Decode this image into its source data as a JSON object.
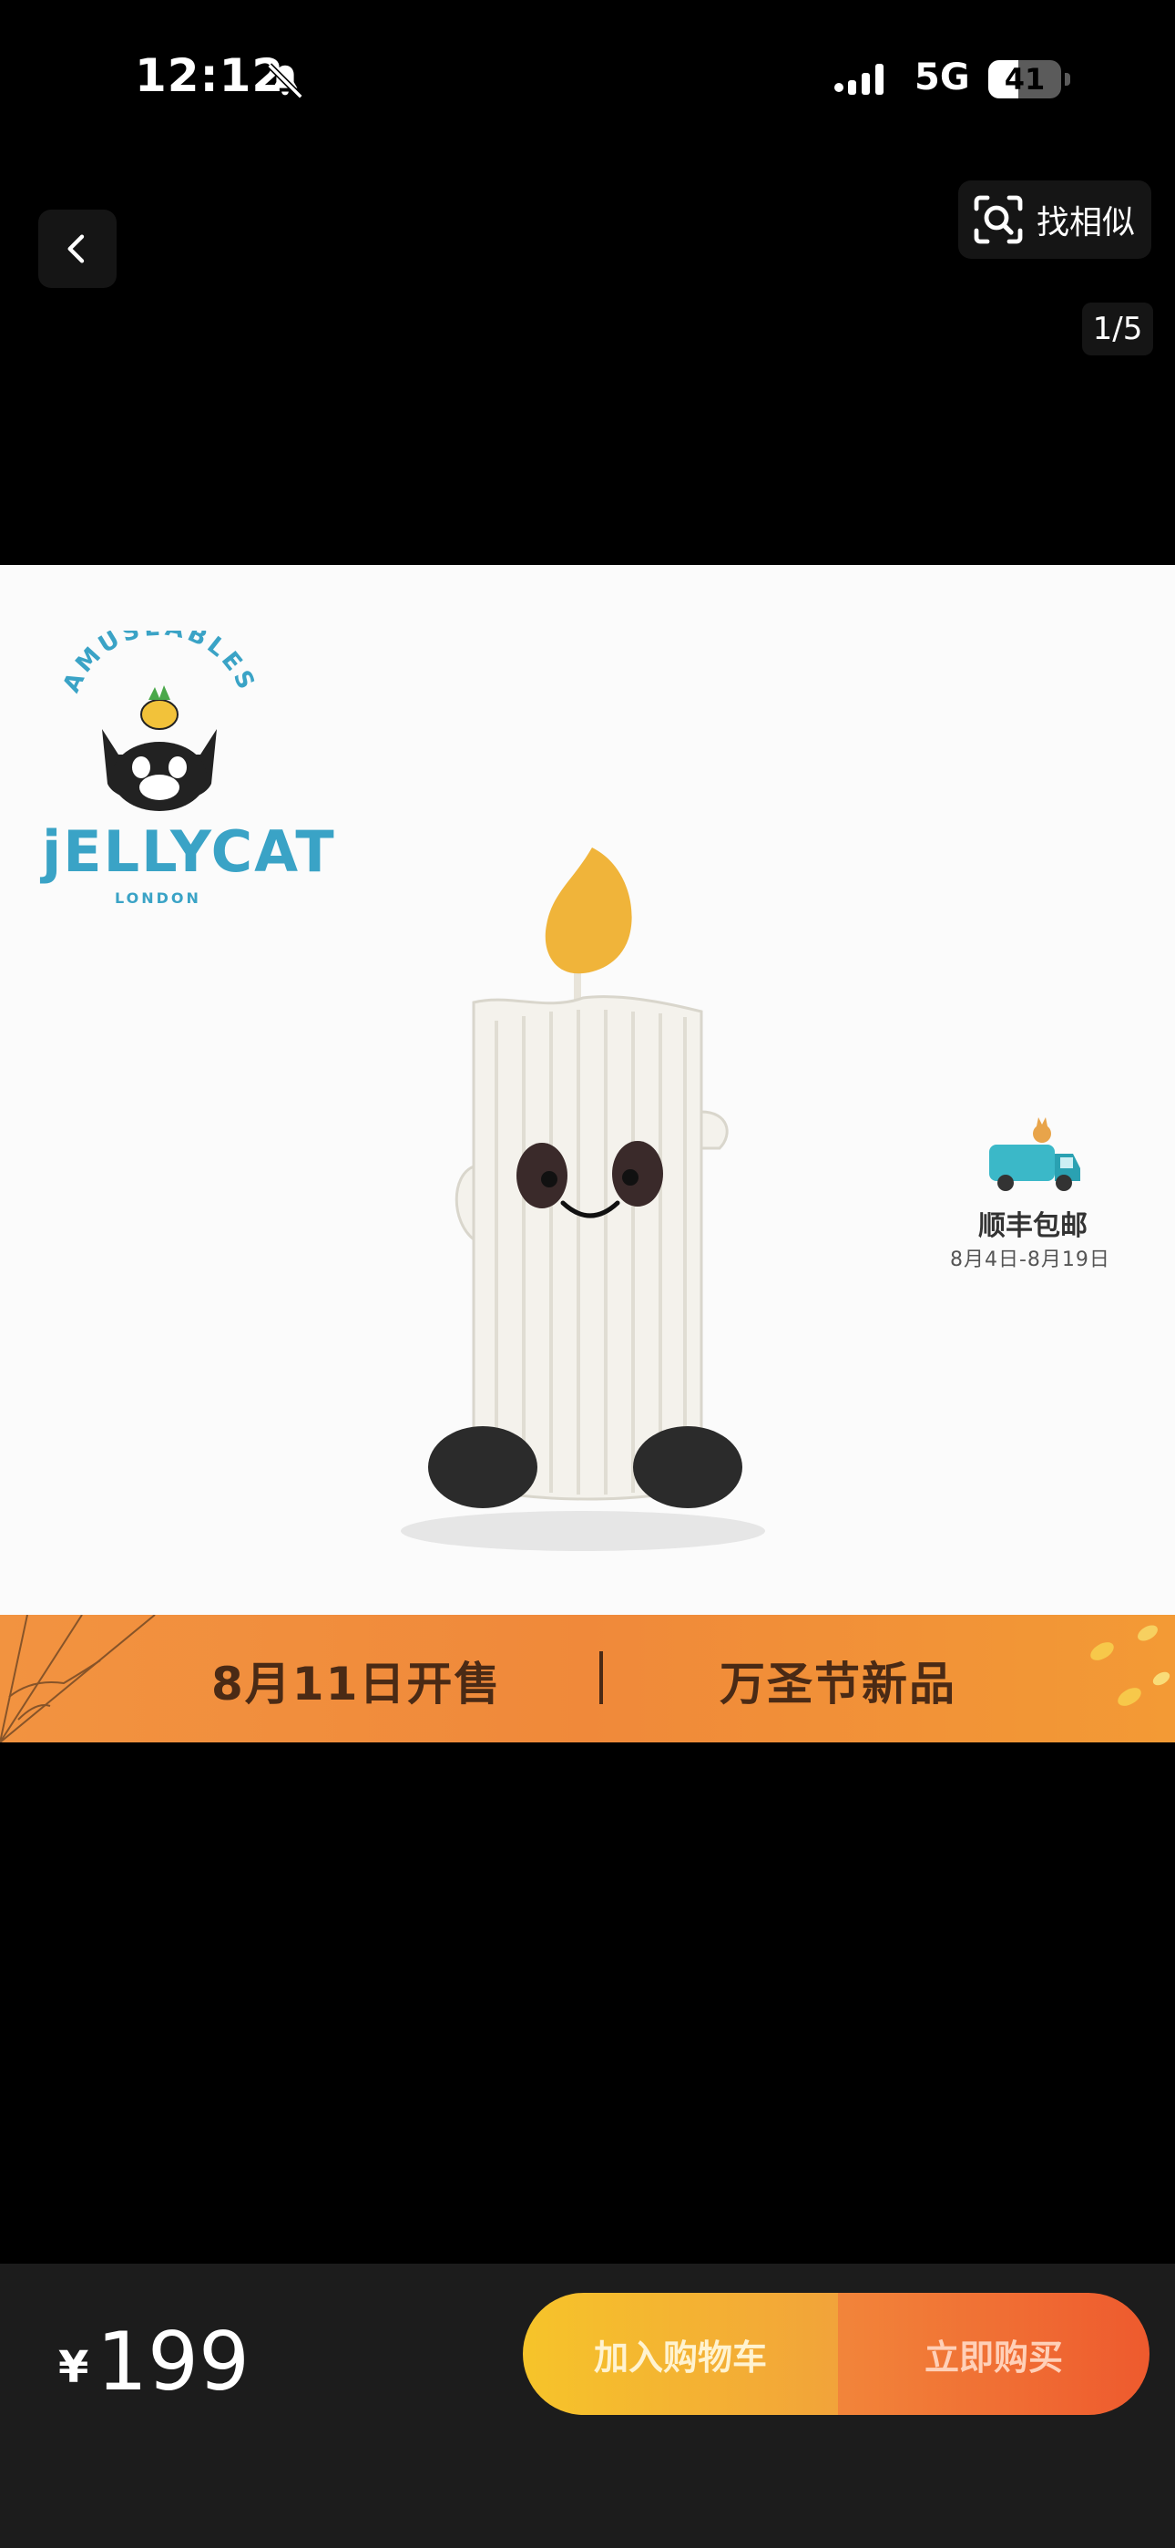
{
  "status_bar": {
    "time": "12:12",
    "network": "5G",
    "battery": "41",
    "battery_level": 0.41
  },
  "nav": {
    "find_similar_label": "找相似",
    "page_indicator": "1/5"
  },
  "product_image": {
    "brand_top": "AMUSEABLES",
    "brand_name": "jELLYCAT",
    "brand_sub": "LONDON",
    "shipping_title": "顺丰包邮",
    "shipping_dates": "8月4日-8月19日",
    "banner_left": "8月11日开售",
    "banner_right": "万圣节新品"
  },
  "bottom_bar": {
    "currency_symbol": "¥",
    "price": "199",
    "add_to_cart_label": "加入购物车",
    "buy_now_label": "立即购买"
  },
  "colors": {
    "brand_teal": "#3aa3c6",
    "banner_orange": "#f0893a",
    "cart_yellow": "#f6c42a",
    "buy_orange": "#ee5a2e"
  }
}
